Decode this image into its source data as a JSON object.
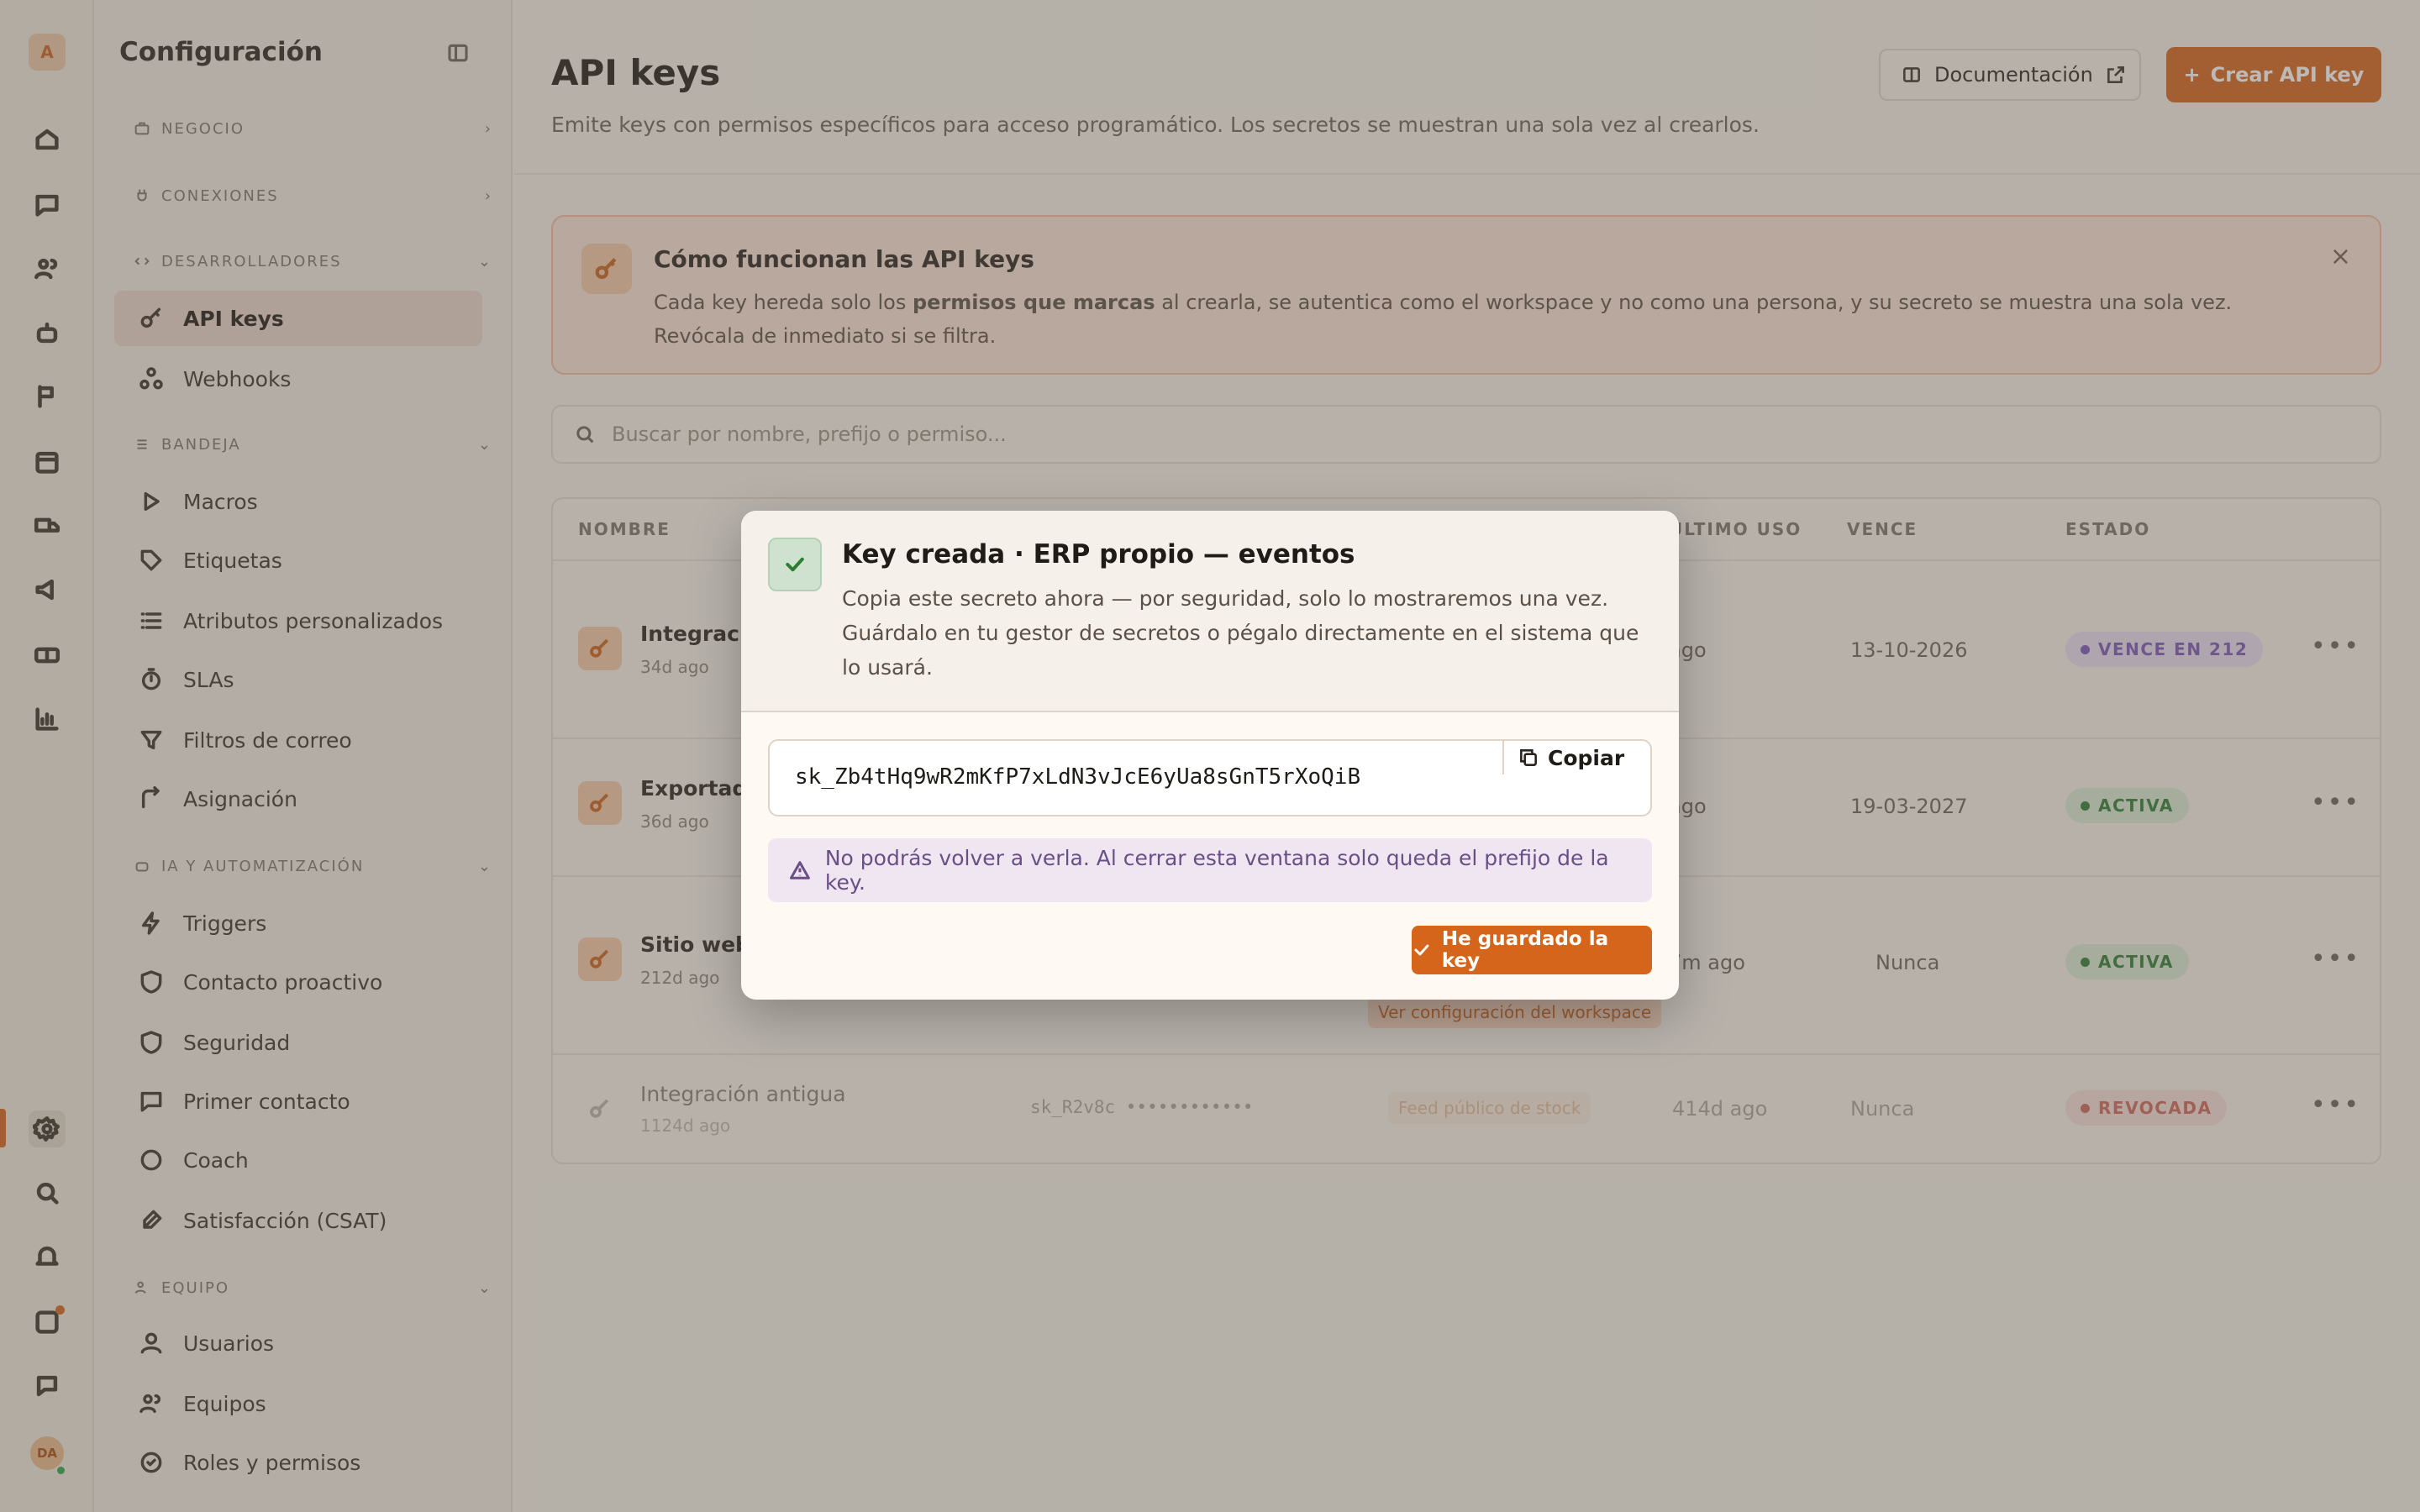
{
  "rail": {
    "logo": "A",
    "avatar": "DA"
  },
  "sidebar": {
    "title": "Configuración",
    "sections": {
      "negocio": "NEGOCIO",
      "conexiones": "CONEXIONES",
      "desarrolladores": "DESARROLLADORES",
      "bandeja": "BANDEJA",
      "ia": "IA Y AUTOMATIZACIÓN",
      "equipo": "EQUIPO"
    },
    "items": {
      "api_keys": "API keys",
      "webhooks": "Webhooks",
      "macros": "Macros",
      "etiquetas": "Etiquetas",
      "atributos": "Atributos personalizados",
      "slas": "SLAs",
      "filtros": "Filtros de correo",
      "asignacion": "Asignación",
      "triggers": "Triggers",
      "contacto": "Contacto proactivo",
      "seguridad": "Seguridad",
      "primer": "Primer contacto",
      "coach": "Coach",
      "csat": "Satisfacción (CSAT)",
      "usuarios": "Usuarios",
      "equipos": "Equipos",
      "roles": "Roles y permisos"
    }
  },
  "header": {
    "title": "API keys",
    "subtitle": "Emite keys con permisos específicos para acceso programático. Los secretos se muestran una sola vez al crearlos.",
    "doc_button": "Documentación",
    "create_button": "Crear API key"
  },
  "info": {
    "title": "Cómo funcionan las API keys",
    "body_pre": "Cada key hereda solo los ",
    "body_bold": "permisos que marcas",
    "body_post": " al crearla, se autentica como el workspace y no como una persona, y su secreto se muestra una sola vez. Revócala de inmediato si se filtra.",
    "close": "×"
  },
  "search": {
    "placeholder": "Buscar por nombre, prefijo o permiso..."
  },
  "table": {
    "headers": {
      "nombre": "NOMBRE",
      "uso": "ÚLTIMO USO",
      "vence": "VENCE",
      "estado": "ESTADO"
    },
    "rows": [
      {
        "name": "Integración",
        "age": "34d ago",
        "uso": "ago",
        "vence": "13-10-2026",
        "estado": "VENCE EN 212"
      },
      {
        "name": "Exportador",
        "age": "36d ago",
        "uso": "ago",
        "vence": "19-03-2027",
        "estado": "ACTIVA"
      },
      {
        "name": "Sitio web",
        "age": "212d ago",
        "uso": "7m ago",
        "vence": "Nunca",
        "estado": "ACTIVA",
        "tag": "Ver configuración del workspace"
      },
      {
        "name": "Integración antigua",
        "age": "1124d ago",
        "prefix": "sk_R2v8c ••••••••••••",
        "tag": "Feed público de stock",
        "uso": "414d ago",
        "vence": "Nunca",
        "estado": "REVOCADA"
      }
    ]
  },
  "modal": {
    "title": "Key creada · ERP propio — eventos",
    "description": "Copia este secreto ahora — por seguridad, solo lo mostraremos una vez. Guárdalo en tu gestor de secretos o pégalo directamente en el sistema que lo usará.",
    "secret": "sk_Zb4tHq9wR2mKfP7xLdN3vJcE6yUa8sGnT5rXoQiB",
    "copy": "Copiar",
    "warning": "No podrás volver a verla. Al cerrar esta ventana solo queda el prefijo de la key.",
    "confirm": "He guardado la key"
  },
  "colors": {
    "accent": "#d4651a",
    "success": "#2e7d32",
    "warning_bg": "#efe6f1"
  }
}
